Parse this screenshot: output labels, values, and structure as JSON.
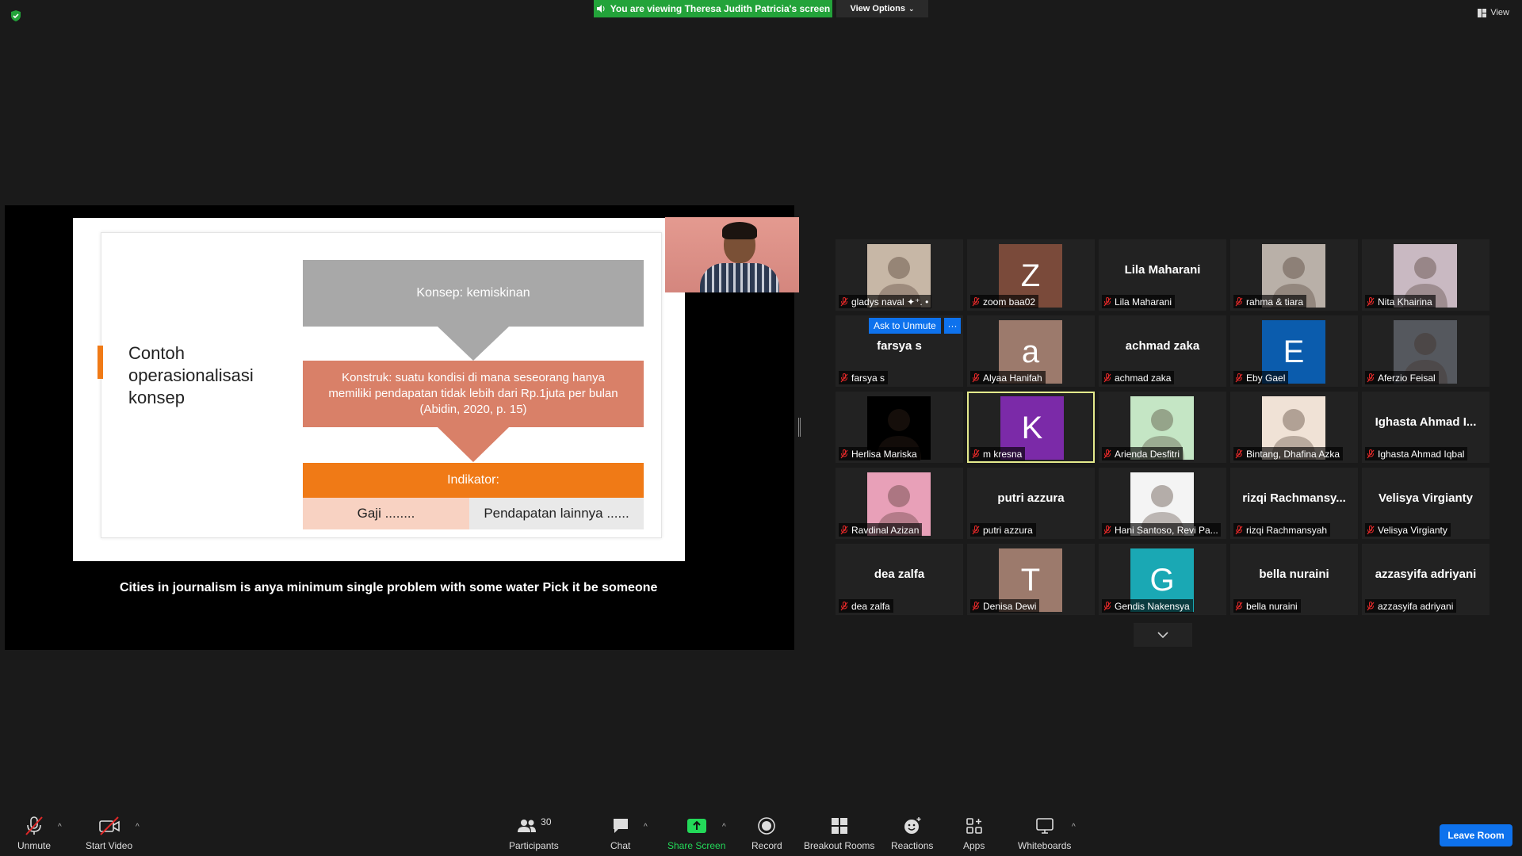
{
  "banner": {
    "viewing_text": "You are viewing Theresa Judith Patricia's screen",
    "view_options": "View Options",
    "view": "View"
  },
  "slide": {
    "title_lines": [
      "Contoh",
      "operasionalisasi",
      "konsep"
    ],
    "konsep": "Konsep: kemiskinan",
    "konstruk": "Konstruk: suatu kondisi di mana seseorang hanya memiliki pendapatan tidak lebih dari Rp.1juta per bulan (Abidin, 2020, p. 15)",
    "indikator": "Indikator:",
    "gaji": "Gaji ........",
    "pendapatan": "Pendapatan lainnya ......"
  },
  "caption": "Cities in journalism is anya minimum single problem with some water Pick it be someone",
  "participants": [
    {
      "name": "gladys naval ✦⁺. •",
      "type": "photo",
      "color": "#c7b7a6"
    },
    {
      "name": "zoom baa02",
      "type": "letter",
      "letter": "Z",
      "color": "#7a4a3a"
    },
    {
      "name": "Lila Maharani",
      "type": "name",
      "big": "Lila Maharani"
    },
    {
      "name": "rahma & tiara",
      "type": "photo",
      "color": "#b9b0a8"
    },
    {
      "name": "Nita Khairina",
      "type": "photo",
      "color": "#c9b9c2"
    },
    {
      "name": "farsya s",
      "type": "name",
      "big": "farsya s",
      "ask": "Ask to Unmute",
      "more": "···"
    },
    {
      "name": "Alyaa Hanifah",
      "type": "letter",
      "letter": "a",
      "color": "#9c7a6c"
    },
    {
      "name": "achmad zaka",
      "type": "name",
      "big": "achmad zaka"
    },
    {
      "name": "Eby Gael",
      "type": "letter",
      "letter": "E",
      "color": "#0b5cad"
    },
    {
      "name": "Aferzio Feisal",
      "type": "photo",
      "color": "#55585e"
    },
    {
      "name": "Herlisa Mariska",
      "type": "photo",
      "color": "#000000"
    },
    {
      "name": "m kresna",
      "type": "letter",
      "letter": "K",
      "color": "#7b2aa8",
      "active": true
    },
    {
      "name": "Arienda Desfitri",
      "type": "photo",
      "color": "#c5e6c5"
    },
    {
      "name": "Bintang, Dhafina Azka",
      "type": "photo",
      "color": "#f0e2d6"
    },
    {
      "name": "Ighasta Ahmad Iqbal",
      "type": "name",
      "big": "Ighasta Ahmad I..."
    },
    {
      "name": "Ravdinal Azizan",
      "type": "photo",
      "color": "#e8a0b8"
    },
    {
      "name": "putri azzura",
      "type": "name",
      "big": "putri azzura"
    },
    {
      "name": "Hani Santoso, Revi Pa...",
      "type": "photo",
      "color": "#f4f4f4"
    },
    {
      "name": "rizqi Rachmansyah",
      "type": "name",
      "big": "rizqi  Rachmansy..."
    },
    {
      "name": "Velisya Virgianty",
      "type": "name",
      "big": "Velisya Virgianty"
    },
    {
      "name": "dea zalfa",
      "type": "name",
      "big": "dea zalfa"
    },
    {
      "name": "Denisa Dewi",
      "type": "letter",
      "letter": "T",
      "color": "#9c7a6c"
    },
    {
      "name": "Gendis Nakensya",
      "type": "letter",
      "letter": "G",
      "color": "#1aa8b4"
    },
    {
      "name": "bella nuraini",
      "type": "name",
      "big": "bella nuraini"
    },
    {
      "name": "azzasyifa adriyani",
      "type": "name",
      "big": "azzasyifa adriyani"
    }
  ],
  "toolbar": {
    "unmute": "Unmute",
    "start_video": "Start Video",
    "participants": "Participants",
    "participants_count": "30",
    "chat": "Chat",
    "share_screen": "Share Screen",
    "record": "Record",
    "breakout": "Breakout Rooms",
    "reactions": "Reactions",
    "apps": "Apps",
    "whiteboards": "Whiteboards",
    "leave": "Leave Room",
    "caret": "^"
  },
  "colors": {
    "accent": "#0e72ed",
    "banner": "#23a33a",
    "share_green": "#23d959",
    "muted_red": "#e02828"
  }
}
